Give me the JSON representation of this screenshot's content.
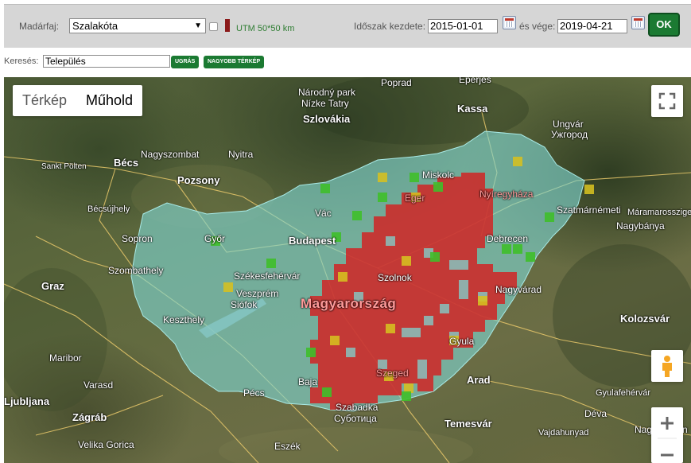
{
  "filters": {
    "species_label": "Madárfaj:",
    "species_value": "Szalakóta",
    "utm_label": "UTM 50*50 km",
    "period_start_label": "Időszak kezdete:",
    "period_start_value": "2015-01-01",
    "period_end_label": "és vége:",
    "period_end_value": "2019-04-21",
    "ok_label": "OK"
  },
  "search": {
    "label": "Keresés:",
    "value": "Település",
    "jump_label": "UGRÁS",
    "bigger_map_label": "NAGYOBB TÉRKÉP"
  },
  "map": {
    "type_map_label": "Térkép",
    "type_satellite_label": "Műhold",
    "country_label": "Magyarország",
    "places": {
      "szlovakia": "Szlovákia",
      "narodny_park": "Národný park",
      "nizke_tatry": "Nízke Tatry",
      "poprad": "Poprad",
      "eperjes": "Eperjes",
      "kassa": "Kassa",
      "ungvar": "Ungvár",
      "uzhorod": "Ужгород",
      "becs": "Bécs",
      "sankt_polten": "Sankt Pölten",
      "nagyszombat": "Nagyszombat",
      "nyitra": "Nyitra",
      "pozsony": "Pozsony",
      "miskolc": "Miskolc",
      "eger": "Eger",
      "nyiregyhaza": "Nyíregyháza",
      "szatmarnemeti": "Szatmárnémeti",
      "maramarossziget": "Máramarossziget",
      "nagybanya": "Nagybánya",
      "becsujhely": "Bécsújhely",
      "sopron": "Sopron",
      "gyor": "Győr",
      "vac": "Vác",
      "budapest": "Budapest",
      "debrecen": "Debrecen",
      "szombathely": "Szombathely",
      "szekesfehervar": "Székesfehérvár",
      "szolnok": "Szolnok",
      "veszprem": "Veszprém",
      "siofok": "Siófok",
      "nagyvarad": "Nagyvárad",
      "graz": "Graz",
      "keszthely": "Keszthely",
      "kolozsvar": "Kolozsvár",
      "gyula": "Gyula",
      "maribor": "Maribor",
      "varasd": "Varasd",
      "szeged": "Szeged",
      "arad": "Arad",
      "pecs": "Pécs",
      "baja": "Baja",
      "gyulafehervar": "Gyulafehérvár",
      "ljubljana": "Ljubljana",
      "zagrab": "Zágráb",
      "velika_gorica": "Velika Gorica",
      "szabadka": "Szabadka",
      "subotica": "Суботица",
      "temesvar": "Temesvár",
      "deva": "Déva",
      "vajdahunyad": "Vajdahunyad",
      "eszek": "Eszék",
      "nagyszeben": "Nagyszeben"
    }
  },
  "colors": {
    "topbar_bg": "#d6d6d6",
    "button_green": "#1b7a32",
    "hungary_overlay": "#7fd6d2",
    "present_red": "#d42020",
    "probable_yellow": "#d6c020",
    "possible_green": "#3fbf2a"
  },
  "icons": {
    "calendar": "calendar-icon",
    "fullscreen": "fullscreen-icon",
    "pegman": "pegman-icon",
    "zoom_in": "zoom-in-icon",
    "zoom_out": "zoom-out-icon",
    "dropdown": "chevron-down-icon"
  }
}
